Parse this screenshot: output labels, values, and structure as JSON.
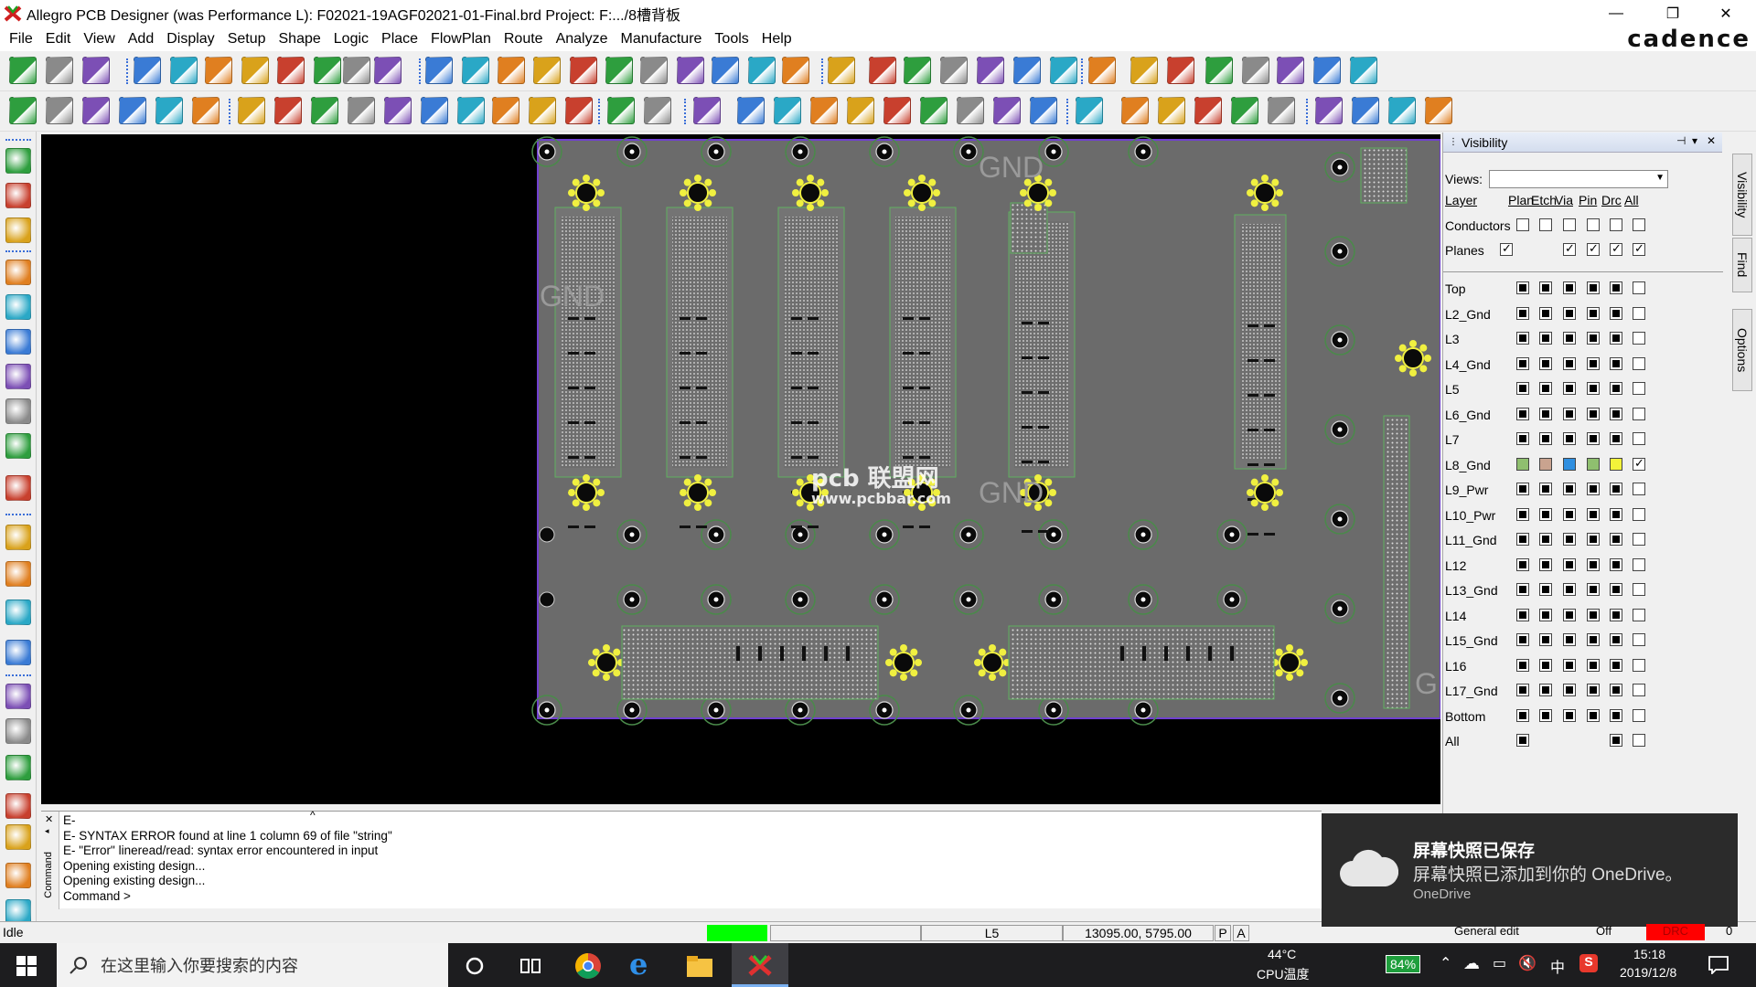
{
  "window": {
    "title": "Allegro PCB Designer (was Performance L): F02021-19AGF02021-01-Final.brd  Project: F:.../8槽背板",
    "logo": "cadence",
    "minimize_icon": "—",
    "restore_icon": "❐",
    "close_icon": "✕"
  },
  "menu": [
    "File",
    "Edit",
    "View",
    "Add",
    "Display",
    "Setup",
    "Shape",
    "Logic",
    "Place",
    "FlowPlan",
    "Route",
    "Analyze",
    "Manufacture",
    "Tools",
    "Help"
  ],
  "canvas": {
    "silk_labels": [
      "GND",
      "GND",
      "GND",
      "G"
    ],
    "watermark_brand": "pcb 联盟网",
    "watermark_url": "www.pcbbar.com"
  },
  "visibility": {
    "title": "Visibility",
    "views_label": "Views:",
    "views_value": "",
    "columns": [
      "Layer",
      "Plan",
      "Etch",
      "Via",
      "Pin",
      "Drc",
      "All"
    ],
    "group_rows": [
      {
        "name": "Conductors",
        "states": [
          "empty",
          "empty",
          "empty",
          "empty",
          "empty",
          "empty"
        ]
      },
      {
        "name": "Planes",
        "states": [
          "checked",
          "none",
          "checked",
          "checked",
          "checked",
          "checked"
        ]
      }
    ],
    "layers": [
      {
        "name": "Top",
        "states": [
          "f",
          "f",
          "f",
          "f",
          "f",
          "e"
        ]
      },
      {
        "name": "L2_Gnd",
        "states": [
          "f",
          "f",
          "f",
          "f",
          "f",
          "e"
        ]
      },
      {
        "name": "L3",
        "states": [
          "f",
          "f",
          "f",
          "f",
          "f",
          "e"
        ]
      },
      {
        "name": "L4_Gnd",
        "states": [
          "f",
          "f",
          "f",
          "f",
          "f",
          "e"
        ]
      },
      {
        "name": "L5",
        "states": [
          "f",
          "f",
          "f",
          "f",
          "f",
          "e"
        ]
      },
      {
        "name": "L6_Gnd",
        "states": [
          "f",
          "f",
          "f",
          "f",
          "f",
          "e"
        ]
      },
      {
        "name": "L7",
        "states": [
          "f",
          "f",
          "f",
          "f",
          "f",
          "e"
        ]
      },
      {
        "name": "L8_Gnd",
        "states": [
          "c1",
          "c2",
          "c3",
          "c4",
          "c5",
          "k"
        ]
      },
      {
        "name": "L9_Pwr",
        "states": [
          "f",
          "f",
          "f",
          "f",
          "f",
          "e"
        ]
      },
      {
        "name": "L10_Pwr",
        "states": [
          "f",
          "f",
          "f",
          "f",
          "f",
          "e"
        ]
      },
      {
        "name": "L11_Gnd",
        "states": [
          "f",
          "f",
          "f",
          "f",
          "f",
          "e"
        ]
      },
      {
        "name": "L12",
        "states": [
          "f",
          "f",
          "f",
          "f",
          "f",
          "e"
        ]
      },
      {
        "name": "L13_Gnd",
        "states": [
          "f",
          "f",
          "f",
          "f",
          "f",
          "e"
        ]
      },
      {
        "name": "L14",
        "states": [
          "f",
          "f",
          "f",
          "f",
          "f",
          "e"
        ]
      },
      {
        "name": "L15_Gnd",
        "states": [
          "f",
          "f",
          "f",
          "f",
          "f",
          "e"
        ]
      },
      {
        "name": "L16",
        "states": [
          "f",
          "f",
          "f",
          "f",
          "f",
          "e"
        ]
      },
      {
        "name": "L17_Gnd",
        "states": [
          "f",
          "f",
          "f",
          "f",
          "f",
          "e"
        ]
      },
      {
        "name": "Bottom",
        "states": [
          "f",
          "f",
          "f",
          "f",
          "f",
          "e"
        ]
      },
      {
        "name": "All",
        "states": [
          "f",
          "n",
          "n",
          "n",
          "f",
          "e"
        ]
      }
    ],
    "l8_colors": [
      "#8fbf6f",
      "#c9a38f",
      "#2f8fe0",
      "#8fbf6f",
      "#f3f33a"
    ]
  },
  "side_tabs": [
    "Visibility",
    "Find",
    "Options"
  ],
  "command": {
    "side_label": "Command",
    "lines": [
      "E-",
      "E- SYNTAX ERROR found at line 1 column 69 of file \"string\"",
      "E- \"Error\" lineread/read: syntax error encountered in input",
      "Opening existing design...",
      "Opening existing design...",
      "Command >"
    ]
  },
  "status": {
    "state": "Idle",
    "layer": "L5",
    "coords": "13095.00, 5795.00",
    "p": "P",
    "a": "A",
    "mode": "General edit",
    "off": "Off",
    "drc": "DRC",
    "count": "0",
    "progress_color": "#00ff00",
    "drc_color": "#ff0000"
  },
  "toast": {
    "title": "屏幕快照已保存",
    "body": "屏幕快照已添加到你的 OneDrive。",
    "source": "OneDrive"
  },
  "taskbar": {
    "search_placeholder": "在这里输入你要搜索的内容",
    "temp": "44°C",
    "temp_label": "CPU温度",
    "battery": "84%",
    "ime": "中",
    "time": "15:18",
    "date": "2019/12/8"
  }
}
